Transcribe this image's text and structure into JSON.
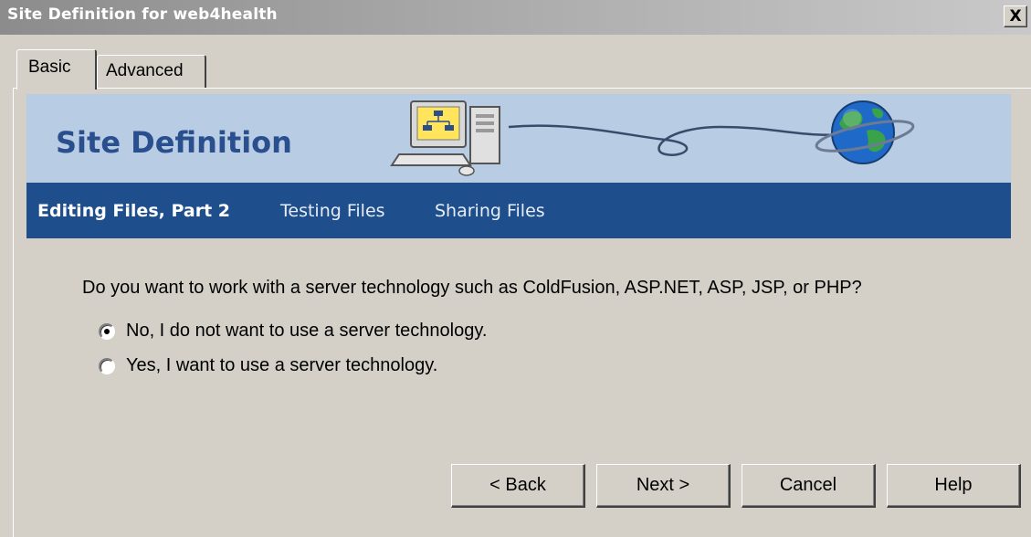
{
  "window": {
    "title": "Site Definition for web4health",
    "close_label": "X"
  },
  "tabs": [
    {
      "label": "Basic",
      "active": true
    },
    {
      "label": "Advanced",
      "active": false
    }
  ],
  "banner": {
    "title": "Site Definition"
  },
  "steps": [
    {
      "label": "Editing Files, Part 2",
      "active": true
    },
    {
      "label": "Testing Files",
      "active": false
    },
    {
      "label": "Sharing Files",
      "active": false
    }
  ],
  "question": "Do you want to work with a server technology such as ColdFusion, ASP.NET, ASP, JSP, or PHP?",
  "options": [
    {
      "label": "No, I do not want to use a server technology.",
      "selected": true
    },
    {
      "label": "Yes, I want to use a server technology.",
      "selected": false
    }
  ],
  "buttons": {
    "back": "< Back",
    "next": "Next >",
    "cancel": "Cancel",
    "help": "Help"
  },
  "icons": {
    "banner_left": "computer-network-icon",
    "banner_right": "globe-icon"
  },
  "colors": {
    "banner_bg": "#b8cce4",
    "banner_title": "#2a4f8e",
    "stepbar_bg": "#1f4e8c",
    "dialog_bg": "#d4d0c8"
  }
}
